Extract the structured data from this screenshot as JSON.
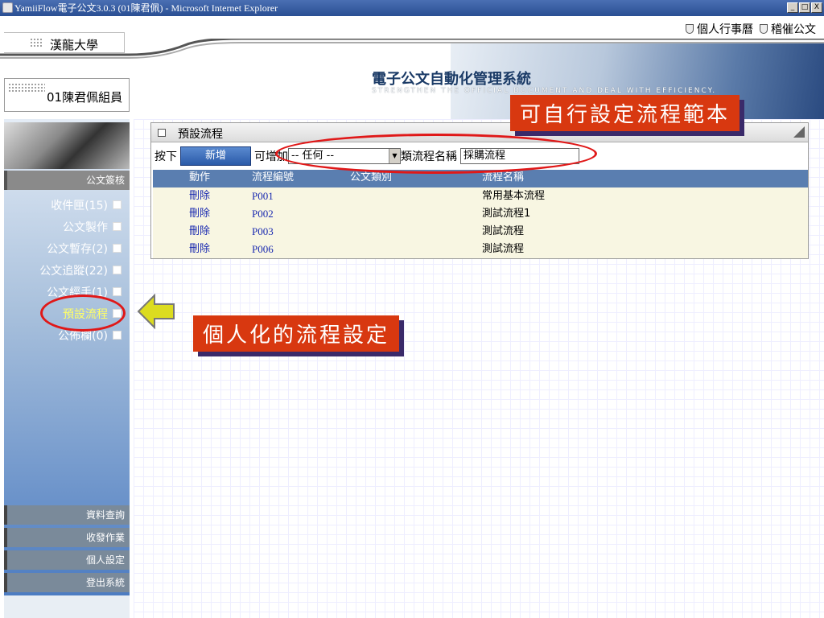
{
  "window": {
    "title": "YamiiFlow電子公文3.0.3 (01陳君佩) - Microsoft Internet Explorer",
    "controls": [
      "_",
      "□",
      "X"
    ]
  },
  "header": {
    "links": [
      "個人行事曆",
      "稽催公文"
    ],
    "school": "漢龍大學",
    "system_title": "電子公文自動化管理系統",
    "system_subtitle": "STRENGTHEN THE OFFICIAL DOCUMENT AND DEAL WITH EFFICIENCY.",
    "user": "01陳君佩組員"
  },
  "sidebar": {
    "section_title": "公文簽核",
    "items": [
      {
        "label": "收件匣(15)"
      },
      {
        "label": "公文製作"
      },
      {
        "label": "公文暫存(2)"
      },
      {
        "label": "公文追蹤(22)"
      },
      {
        "label": "公文經手(1)"
      },
      {
        "label": "預設流程",
        "active": true
      },
      {
        "label": "公佈欄(0)"
      }
    ],
    "footer": [
      "資料查詢",
      "收發作業",
      "個人設定",
      "登出系統"
    ]
  },
  "panel": {
    "title": "預設流程",
    "toolbar": {
      "prefix": "按下",
      "new_button": "新增",
      "middle": "可增加",
      "select_value": "-- 任何 --",
      "suffix": "類流程名稱",
      "name_value": "採購流程"
    },
    "columns": [
      "動作",
      "流程編號",
      "公文類別",
      "流程名稱"
    ],
    "rows": [
      {
        "action": "刪除",
        "code": "P001",
        "category": "",
        "name": "常用基本流程"
      },
      {
        "action": "刪除",
        "code": "P002",
        "category": "",
        "name": "測試流程1"
      },
      {
        "action": "刪除",
        "code": "P003",
        "category": "",
        "name": "測試流程"
      },
      {
        "action": "刪除",
        "code": "P006",
        "category": "",
        "name": "測試流程"
      }
    ]
  },
  "callouts": {
    "top": "可自行設定流程範本",
    "bottom": "個人化的流程設定"
  },
  "colors": {
    "callout": "#d83810",
    "ellipse": "#e01818",
    "table_header": "#5a7eb0",
    "row_bg": "#f8f6e2"
  }
}
